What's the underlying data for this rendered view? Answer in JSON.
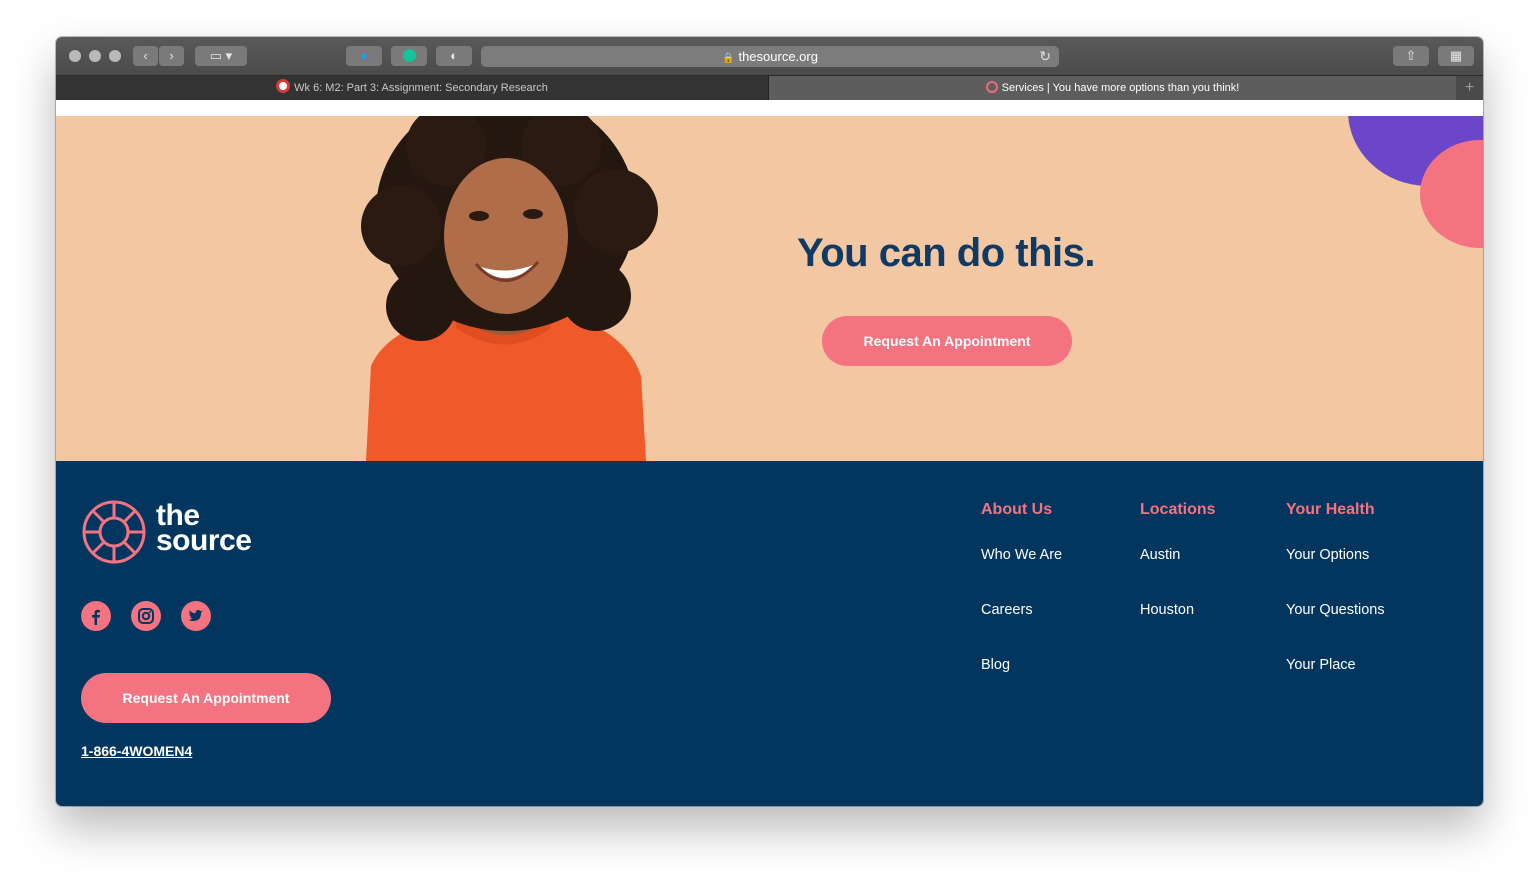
{
  "browser": {
    "url": "thesource.org",
    "tabs": [
      {
        "label": "Wk 6: M2: Part 3: Assignment: Secondary Research"
      },
      {
        "label": "Services | You have more options than you think!"
      }
    ],
    "new_tab_label": "+"
  },
  "hero": {
    "title": "You can do this.",
    "cta_label": "Request An Appointment"
  },
  "footer": {
    "logo_line1": "the",
    "logo_line2": "source",
    "social": [
      "facebook-icon",
      "instagram-icon",
      "twitter-icon"
    ],
    "cta_label": "Request An Appointment",
    "phone": "1-866-4WOMEN4",
    "columns": [
      {
        "heading": "About Us",
        "links": [
          "Who We Are",
          "Careers",
          "Blog"
        ]
      },
      {
        "heading": "Locations",
        "links": [
          "Austin",
          "Houston"
        ]
      },
      {
        "heading": "Your Health",
        "links": [
          "Your Options",
          "Your Questions",
          "Your Place"
        ]
      }
    ]
  },
  "colors": {
    "navy": "#02365f",
    "coral": "#f47380",
    "peach": "#f4c7a3",
    "purple": "#6b46c9"
  }
}
